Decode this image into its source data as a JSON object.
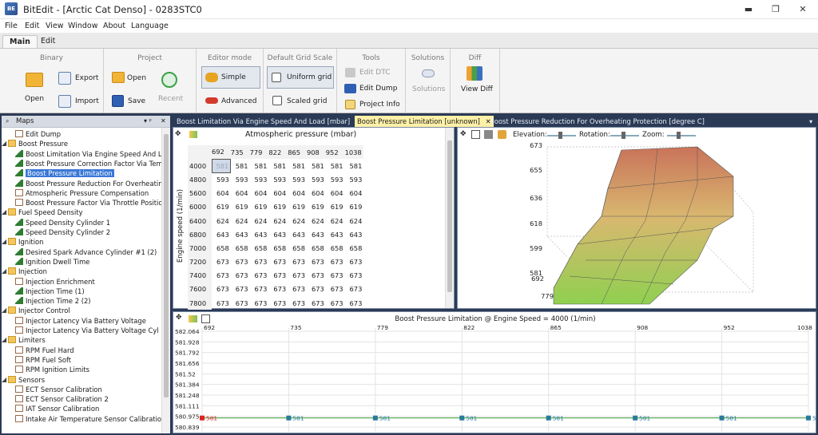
{
  "app": {
    "icon_text": "BE",
    "title": "BitEdit - [Arctic Cat Denso] - 0283STC0"
  },
  "window_controls": {
    "minimize": "▬",
    "restore": "❐",
    "close": "✕"
  },
  "menu": [
    "File",
    "Edit",
    "View",
    "Window",
    "About",
    "Language"
  ],
  "ribbon_tabs": [
    "Main",
    "Edit"
  ],
  "ribbon": {
    "binary": {
      "title": "Binary",
      "open": "Open",
      "export": "Export",
      "import": "Import"
    },
    "project": {
      "title": "Project",
      "open": "Open",
      "save": "Save",
      "recent": "Recent"
    },
    "editor_mode": {
      "title": "Editor mode",
      "simple": "Simple",
      "advanced": "Advanced"
    },
    "grid_scale": {
      "title": "Default Grid Scale",
      "uniform": "Uniform grid",
      "scaled": "Scaled grid"
    },
    "tools": {
      "title": "Tools",
      "edit_dtc": "Edit DTC",
      "edit_dump": "Edit Dump",
      "project_info": "Project Info"
    },
    "solutions": {
      "title": "Solutions",
      "label": "Solutions"
    },
    "diff": {
      "title": "Diff",
      "view_diff": "View Diff"
    }
  },
  "maps_panel": {
    "title": "Maps",
    "pin": "▾ ᵖ",
    "close": "✕"
  },
  "tree": [
    {
      "label": "Edit Dump",
      "level": 1,
      "icon": "grid-icon"
    },
    {
      "label": "Boost Pressure",
      "level": 0,
      "icon": "folder-icon"
    },
    {
      "label": "Boost Limitation Via Engine Speed And Load",
      "level": 1,
      "icon": "3d-map-icon"
    },
    {
      "label": "Boost Pressure Correction Factor Via Temp",
      "level": 1,
      "icon": "3d-map-icon"
    },
    {
      "label": "Boost Pressure Limitation",
      "level": 1,
      "icon": "3d-map-icon",
      "selected": true
    },
    {
      "label": "Boost Pressure Reduction For Overheating",
      "level": 1,
      "icon": "3d-map-icon"
    },
    {
      "label": "Atmospheric Pressure Compensation",
      "level": 1,
      "icon": "grid-icon"
    },
    {
      "label": "Boost Pressure Factor Via Throttle Position",
      "level": 1,
      "icon": "grid-icon"
    },
    {
      "label": "Fuel Speed Density",
      "level": 0,
      "icon": "folder-icon"
    },
    {
      "label": "Speed Density Cylinder 1",
      "level": 1,
      "icon": "3d-map-icon"
    },
    {
      "label": "Speed Density Cylinder 2",
      "level": 1,
      "icon": "3d-map-icon"
    },
    {
      "label": "Ignition",
      "level": 0,
      "icon": "folder-icon"
    },
    {
      "label": "Desired Spark Advance Cylinder #1 (2)",
      "level": 1,
      "icon": "3d-map-icon"
    },
    {
      "label": "Ignition Dwell Time",
      "level": 1,
      "icon": "3d-map-icon"
    },
    {
      "label": "Injection",
      "level": 0,
      "icon": "folder-icon"
    },
    {
      "label": "Injection Enrichment",
      "level": 1,
      "icon": "grid-icon"
    },
    {
      "label": "Injection Time (1)",
      "level": 1,
      "icon": "3d-map-icon"
    },
    {
      "label": "Injection Time 2 (2)",
      "level": 1,
      "icon": "3d-map-icon"
    },
    {
      "label": "Injector Control",
      "level": 0,
      "icon": "folder-icon"
    },
    {
      "label": "Injector Latency Via Battery Voltage",
      "level": 1,
      "icon": "grid-icon"
    },
    {
      "label": "Injector Latency Via Battery Voltage Cyl 2",
      "level": 1,
      "icon": "grid-icon"
    },
    {
      "label": "Limiters",
      "level": 0,
      "icon": "folder-icon"
    },
    {
      "label": "RPM Fuel Hard",
      "level": 1,
      "icon": "grid-icon"
    },
    {
      "label": "RPM Fuel Soft",
      "level": 1,
      "icon": "grid-icon"
    },
    {
      "label": "RPM Ignition Limits",
      "level": 1,
      "icon": "grid-icon"
    },
    {
      "label": "Sensors",
      "level": 0,
      "icon": "folder-icon"
    },
    {
      "label": "ECT Sensor Calibration",
      "level": 1,
      "icon": "grid-icon"
    },
    {
      "label": "ECT Sensor Calibration 2",
      "level": 1,
      "icon": "grid-icon"
    },
    {
      "label": "IAT Sensor Calibration",
      "level": 1,
      "icon": "grid-icon"
    },
    {
      "label": "Intake Air Temperature Sensor Calibration",
      "level": 1,
      "icon": "grid-icon"
    }
  ],
  "doc_tabs": [
    {
      "label": "Boost Limitation Via Engine Speed And Load [mbar]",
      "active": false
    },
    {
      "label": "Boost Pressure Limitation [unknown]",
      "active": true
    },
    {
      "label": "Boost Pressure Reduction For Overheating Protection [degree C]",
      "active": false
    }
  ],
  "map_table": {
    "x_axis_title": "Atmospheric pressure (mbar)",
    "y_axis_title": "Engine speed (1/min)",
    "columns": [
      "692",
      "735",
      "779",
      "822",
      "865",
      "908",
      "952",
      "1038"
    ],
    "rows": [
      {
        "rpm": "4000",
        "values": [
          "581",
          "581",
          "581",
          "581",
          "581",
          "581",
          "581",
          "581"
        ]
      },
      {
        "rpm": "4800",
        "values": [
          "593",
          "593",
          "593",
          "593",
          "593",
          "593",
          "593",
          "593"
        ]
      },
      {
        "rpm": "5600",
        "values": [
          "604",
          "604",
          "604",
          "604",
          "604",
          "604",
          "604",
          "604"
        ]
      },
      {
        "rpm": "6000",
        "values": [
          "619",
          "619",
          "619",
          "619",
          "619",
          "619",
          "619",
          "619"
        ]
      },
      {
        "rpm": "6400",
        "values": [
          "624",
          "624",
          "624",
          "624",
          "624",
          "624",
          "624",
          "624"
        ]
      },
      {
        "rpm": "6800",
        "values": [
          "643",
          "643",
          "643",
          "643",
          "643",
          "643",
          "643",
          "643"
        ]
      },
      {
        "rpm": "7000",
        "values": [
          "658",
          "658",
          "658",
          "658",
          "658",
          "658",
          "658",
          "658"
        ]
      },
      {
        "rpm": "7200",
        "values": [
          "673",
          "673",
          "673",
          "673",
          "673",
          "673",
          "673",
          "673"
        ]
      },
      {
        "rpm": "7400",
        "values": [
          "673",
          "673",
          "673",
          "673",
          "673",
          "673",
          "673",
          "673"
        ]
      },
      {
        "rpm": "7600",
        "values": [
          "673",
          "673",
          "673",
          "673",
          "673",
          "673",
          "673",
          "673"
        ]
      },
      {
        "rpm": "7800",
        "values": [
          "673",
          "673",
          "673",
          "673",
          "673",
          "673",
          "673",
          "673"
        ]
      }
    ]
  },
  "plot3d": {
    "elevation_label": "Elevation:",
    "rotation_label": "Rotation:",
    "zoom_label": "Zoom:",
    "z_ticks": [
      "673",
      "655",
      "636",
      "618",
      "599",
      "581"
    ],
    "x_ticks": [
      "692",
      "779"
    ]
  },
  "line_graph": {
    "title": "Boost Pressure Limitation @ Engine Speed = 4000 (1/min)",
    "x_ticks": [
      "692",
      "735",
      "779",
      "822",
      "865",
      "908",
      "952",
      "1038"
    ],
    "y_ticks": [
      "582.064",
      "581.928",
      "581.792",
      "581.656",
      "581.52",
      "581.384",
      "581.248",
      "581.111",
      "580.975",
      "580.839"
    ],
    "point_labels": [
      "581",
      "581",
      "581",
      "581",
      "581",
      "581",
      "581",
      "581"
    ],
    "colors": {
      "point": "#2a7a9a",
      "selected_point": "#e02020",
      "line": "#2e9a2e"
    }
  }
}
